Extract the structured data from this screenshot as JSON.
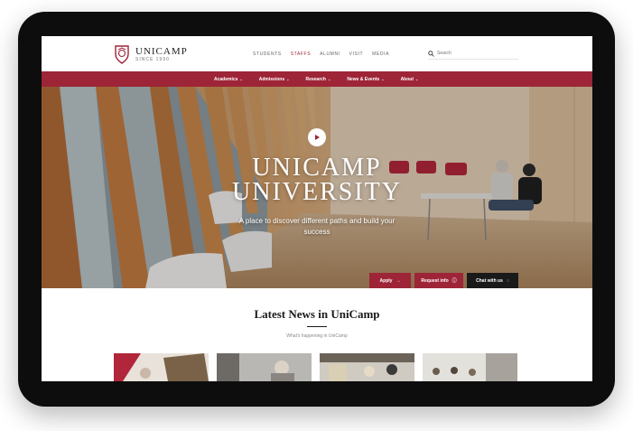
{
  "brand": {
    "name": "UNICAMP",
    "since": "SINCE 1990",
    "accent": "#9d2537"
  },
  "top_links": [
    "STUDENTS",
    "STAFFS",
    "ALUMNI",
    "VISIT",
    "MEDIA"
  ],
  "active_top_link": "STAFFS",
  "search": {
    "placeholder": "Search"
  },
  "main_nav": [
    {
      "label": "Academics"
    },
    {
      "label": "Admissions"
    },
    {
      "label": "Research"
    },
    {
      "label": "News & Events"
    },
    {
      "label": "About"
    }
  ],
  "hero": {
    "title_line1": "UNICAMP",
    "title_line2": "UNIVERSITY",
    "subtitle": "A place to discover different paths and build your success",
    "play_icon": "play-icon"
  },
  "cta": {
    "apply": "Apply",
    "request_info": "Request info",
    "chat": "Chat with us"
  },
  "news": {
    "title": "Latest News in UniCamp",
    "subtitle": "What's happening in UniCamp"
  }
}
